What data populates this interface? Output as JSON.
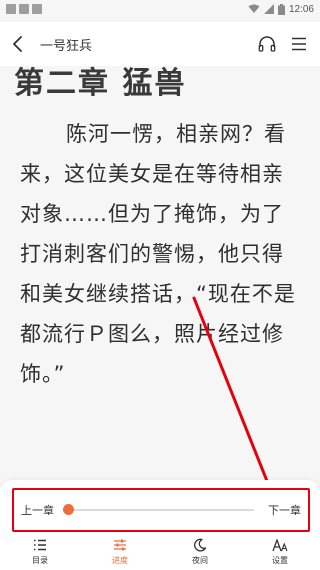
{
  "status_bar": {
    "time": "12:06"
  },
  "header": {
    "title": "一号狂兵"
  },
  "content": {
    "chapter_title": "第二章 猛兽",
    "paragraph": "陈河一愣，相亲网？看来，这位美女是在等待相亲对象……但为了掩饰，为了打消刺客们的警惕，他只得和美女继续搭话，“现在不是都流行Ｐ图么，照片经过修饰。”"
  },
  "progress": {
    "prev_label": "上一章",
    "next_label": "下一章",
    "value": 0.02,
    "accent": "#f06b3c"
  },
  "annotation_color": "#e3000f",
  "bottom_nav": {
    "items": [
      {
        "label": "目录",
        "icon": "list-icon",
        "active": false
      },
      {
        "label": "进度",
        "icon": "sliders-icon",
        "active": true
      },
      {
        "label": "夜间",
        "icon": "moon-icon",
        "active": false
      },
      {
        "label": "设置",
        "icon": "font-size-icon",
        "active": false
      }
    ]
  }
}
